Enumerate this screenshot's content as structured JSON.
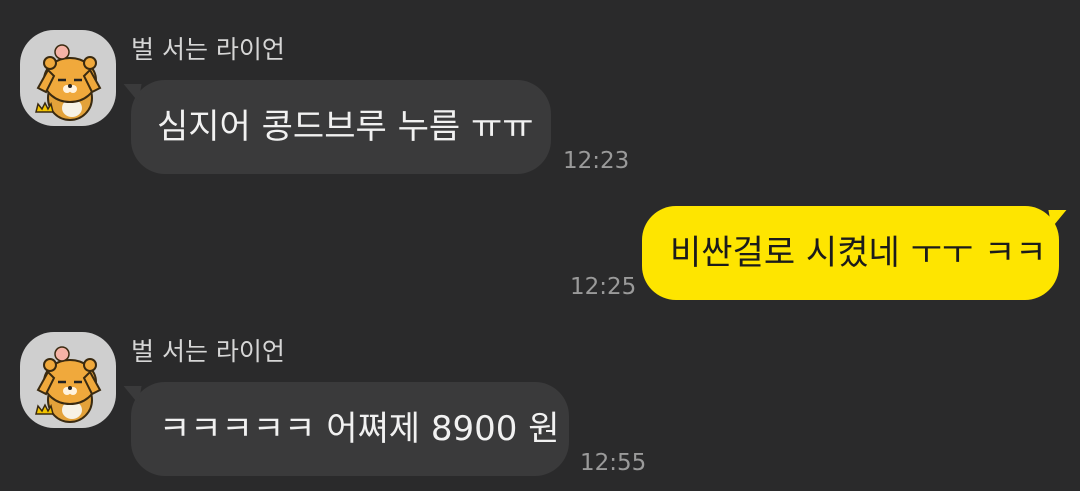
{
  "colors": {
    "background": "#2a2a2b",
    "incoming_bubble": "#3a3a3b",
    "outgoing_bubble": "#fee500",
    "avatar_bg": "#cfcfcf"
  },
  "messages": [
    {
      "direction": "incoming",
      "sender": "벌 서는 라이언",
      "avatar_icon": "ryan-character-icon",
      "text": "심지어 콩드브루 누름 ㅠㅠ",
      "time": "12:23"
    },
    {
      "direction": "outgoing",
      "text": "비싼걸로 시켰네 ㅜㅜ ㅋㅋ",
      "time": "12:25"
    },
    {
      "direction": "incoming",
      "sender": "벌 서는 라이언",
      "avatar_icon": "ryan-character-icon",
      "text": "ㅋㅋㅋㅋㅋ 어쪄제 8900 원",
      "time": "12:55"
    }
  ]
}
